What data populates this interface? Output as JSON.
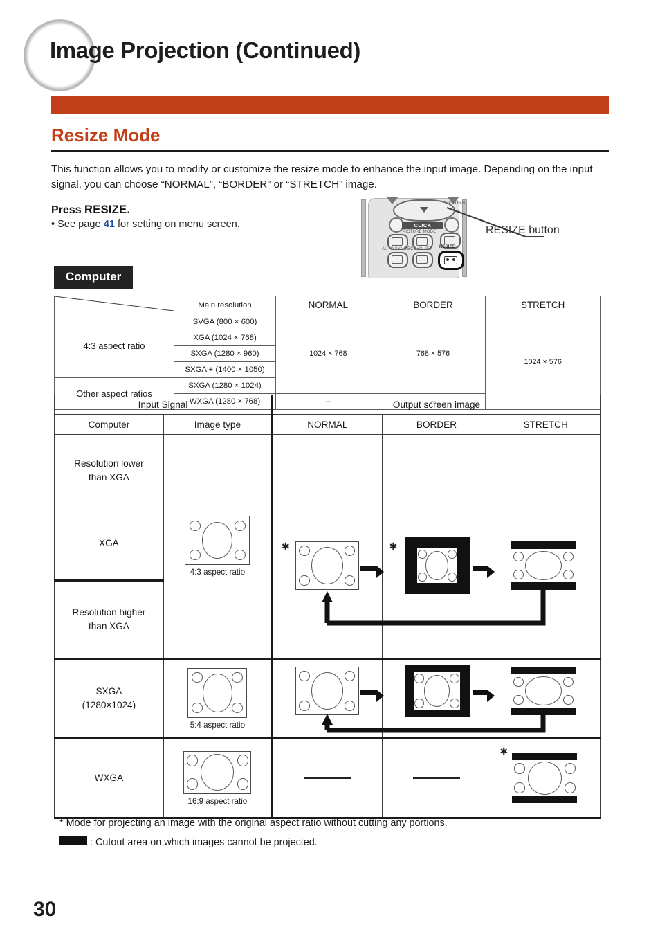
{
  "page": {
    "title": "Image Projection (Continued)",
    "number": "30"
  },
  "section": {
    "heading": "Resize Mode",
    "intro": "This function allows you to modify or customize the resize mode to enhance the input image. Depending on the input signal, you can choose “NORMAL”, “BORDER” or “STRETCH” image.",
    "press_prefix": "Press ",
    "press_key": "RESIZE.",
    "see_page_before": "• See page ",
    "see_page_num": "41",
    "see_page_after": " for setting on menu screen.",
    "accent_color": "#c1401a"
  },
  "remote": {
    "callout_label": "RESIZE button",
    "labels": {
      "return": "RETURN",
      "click": "CLICK",
      "picture_mode": "PICTURE MODE",
      "auto_sync": "AUTO SYNC",
      "eco_quiet": "ECO+QUIET",
      "resize": "RESIZE"
    }
  },
  "badge": {
    "computer": "Computer"
  },
  "table1": {
    "headers": {
      "main_resolution": "Main resolution",
      "normal": "NORMAL",
      "border": "BORDER",
      "stretch": "STRETCH"
    },
    "groups": [
      {
        "label": "4:3 aspect ratio",
        "rows": [
          "SVGA (800 × 600)",
          "XGA (1024 × 768)",
          "SXGA (1280 × 960)",
          "SXGA + (1400 × 1050)"
        ]
      },
      {
        "label": "Other aspect ratios",
        "rows": [
          "SXGA (1280 × 1024)",
          "WXGA (1280 × 768)"
        ]
      }
    ],
    "values": {
      "normal_main": "1024 × 768",
      "border_main": "768 × 576",
      "stretch_main": "1024 × 576",
      "normal_wxga": "–",
      "border_wxga": "–"
    }
  },
  "table2": {
    "headers": {
      "input_signal": "Input Signal",
      "output_screen_image": "Output screen image",
      "computer": "Computer",
      "image_type": "Image type",
      "normal": "NORMAL",
      "border": "BORDER",
      "stretch": "STRETCH"
    },
    "rows": [
      {
        "computer": "Resolution lower\nthan XGA"
      },
      {
        "computer": "XGA"
      },
      {
        "computer": "Resolution higher\nthan XGA"
      },
      {
        "computer": "SXGA\n(1280 × 1024)"
      },
      {
        "computer": "WXGA"
      }
    ],
    "row_labels": {
      "lower": "Resolution lower",
      "lower2": "than XGA",
      "xga": "XGA",
      "higher": "Resolution higher",
      "higher2": "than XGA",
      "sxga": "SXGA",
      "sxga_res": "(1280×1024)",
      "wxga": "WXGA"
    },
    "captions": {
      "aspect_43": "4:3 aspect ratio",
      "aspect_54": "5:4 aspect ratio",
      "aspect_169": "16:9 aspect ratio"
    },
    "marks": {
      "star": "✳",
      "dash": "—"
    }
  },
  "footnotes": {
    "note1": "* Mode for projecting an image with the original aspect ratio without cutting any portions.",
    "note2": ": Cutout area on which images cannot be projected."
  }
}
